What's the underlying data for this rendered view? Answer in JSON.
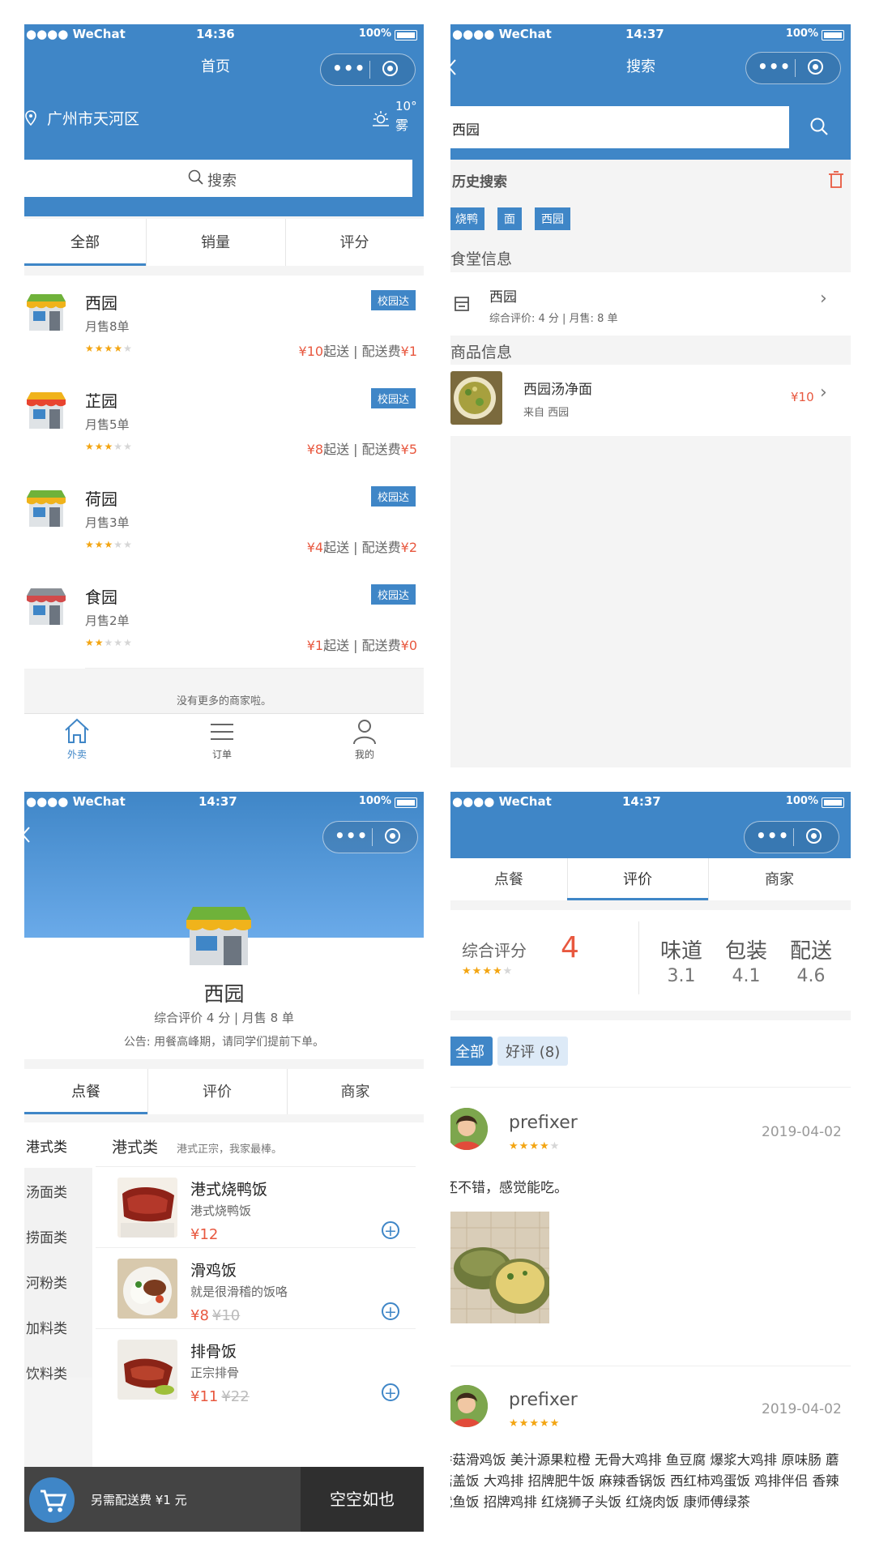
{
  "colors": {
    "primary": "#3f86c7",
    "price": "#e8583f",
    "star": "#f3a512"
  },
  "status_bars": {
    "s1": {
      "carrier": "●●●● WeChat",
      "time": "14:36",
      "battery": "100%"
    },
    "s2": {
      "carrier": "●●●● WeChat",
      "time": "14:37",
      "battery": "100%"
    },
    "s3": {
      "carrier": "●●●● WeChat",
      "time": "14:37",
      "battery": "100%"
    },
    "s4": {
      "carrier": "●●●● WeChat",
      "time": "14:37",
      "battery": "100%"
    }
  },
  "home": {
    "title": "首页",
    "location": "广州市天河区",
    "weather": {
      "temp": "10°",
      "desc": "雾",
      "icon": "sun-icon"
    },
    "search_label": "搜索",
    "tabs": [
      "全部",
      "销量",
      "评分"
    ],
    "shops": [
      {
        "name": "西园",
        "sales": "月售8单",
        "rating": 4,
        "badge": "校园达",
        "min": "¥10",
        "fee": "¥1"
      },
      {
        "name": "芷园",
        "sales": "月售5单",
        "rating": 3,
        "badge": "校园达",
        "min": "¥8",
        "fee": "¥5"
      },
      {
        "name": "荷园",
        "sales": "月售3单",
        "rating": 3,
        "badge": "校园达",
        "min": "¥4",
        "fee": "¥2"
      },
      {
        "name": "食园",
        "sales": "月售2单",
        "rating": 2,
        "badge": "校园达",
        "min": "¥1",
        "fee": "¥0"
      }
    ],
    "min_suffix": "起送 | 配送费",
    "no_more": "没有更多的商家啦。",
    "bottom_nav": [
      "外卖",
      "订单",
      "我的"
    ]
  },
  "search": {
    "title": "搜索",
    "query": "西园",
    "history_title": "历史搜索",
    "history_tags": [
      "烧鸭",
      "面",
      "西园"
    ],
    "canteen_section": "食堂信息",
    "canteen": {
      "name": "西园",
      "meta": "综合评价: 4 分 | 月售: 8 单"
    },
    "goods_section": "商品信息",
    "goods": {
      "name": "西园汤净面",
      "from": "来自 西园",
      "price": "¥10"
    }
  },
  "shop": {
    "name": "西园",
    "meta": "综合评价 4 分 |  月售 8 单",
    "notice": "公告: 用餐高峰期，请同学们提前下单。",
    "tabs": [
      "点餐",
      "评价",
      "商家"
    ],
    "categories": [
      "港式类",
      "汤面类",
      "捞面类",
      "河粉类",
      "加料类",
      "饮料类"
    ],
    "section_title": "港式类",
    "section_desc": "港式正宗，我家最棒。",
    "foods": [
      {
        "name": "港式烧鸭饭",
        "desc": "港式烧鸭饭",
        "price": "¥12",
        "old": ""
      },
      {
        "name": "滑鸡饭",
        "desc": "就是很滑稽的饭咯",
        "price": "¥8",
        "old": "¥10"
      },
      {
        "name": "排骨饭",
        "desc": "正宗排骨",
        "price": "¥11",
        "old": "¥22"
      }
    ],
    "cart_fee": "另需配送费 ¥1 元",
    "cart_submit": "空空如也"
  },
  "reviews": {
    "tabs": [
      "点餐",
      "评价",
      "商家"
    ],
    "overall_label": "综合评分",
    "overall_score": "4",
    "overall_rating": 4,
    "sub_scores": [
      {
        "label": "味道",
        "value": "3.1"
      },
      {
        "label": "包装",
        "value": "4.1"
      },
      {
        "label": "配送",
        "value": "4.6"
      }
    ],
    "filters": [
      "全部",
      "好评 (8)"
    ],
    "items": [
      {
        "user": "prefixer",
        "rating": 4,
        "date": "2019-04-02",
        "text": "还不错，感觉能吃。"
      },
      {
        "user": "prefixer",
        "rating": 5,
        "date": "2019-04-02",
        "text": "香菇滑鸡饭 美汁源果粒橙 无骨大鸡排 鱼豆腐 爆浆大鸡排 原味肠 蘑菇盖饭 大鸡排 招牌肥牛饭 麻辣香锅饭 西红柿鸡蛋饭 鸡排伴侣 香辣鱿鱼饭 招牌鸡排 红烧狮子头饭 红烧肉饭 康师傅绿茶"
      }
    ]
  }
}
